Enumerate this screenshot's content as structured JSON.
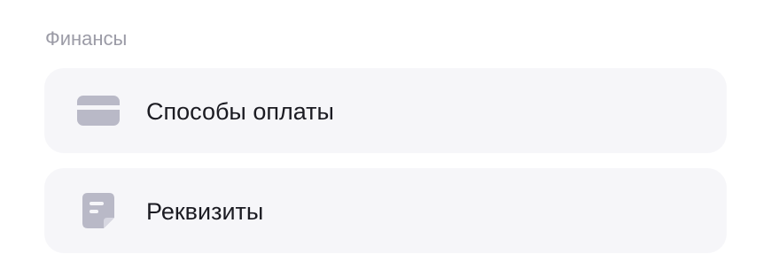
{
  "section": {
    "title": "Финансы"
  },
  "items": [
    {
      "label": "Способы оплаты",
      "icon": "credit-card-icon"
    },
    {
      "label": "Реквизиты",
      "icon": "document-icon"
    }
  ],
  "colors": {
    "item_background": "#f6f6f9",
    "icon": "#b9b9c7",
    "section_title": "#9b9ba6",
    "label": "#1b1b22"
  }
}
